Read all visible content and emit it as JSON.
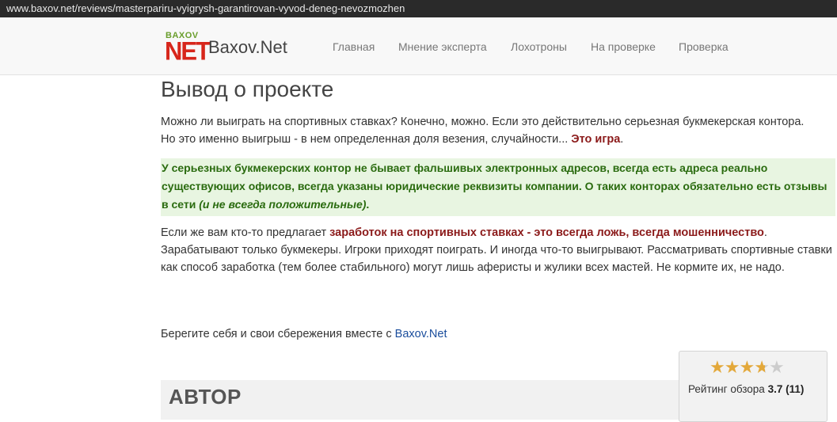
{
  "browser": {
    "url": "www.baxov.net/reviews/masterpariru-vyigrysh-garantirovan-vyvod-deneg-nevozmozhen"
  },
  "header": {
    "logo": {
      "top_text": "BAXOV",
      "main_text": "NET"
    },
    "brand": "Baxov.Net",
    "nav": [
      {
        "label": "Главная"
      },
      {
        "label": "Мнение эксперта"
      },
      {
        "label": "Лохотроны"
      },
      {
        "label": "На проверке"
      },
      {
        "label": "Проверка"
      }
    ]
  },
  "article": {
    "heading": "Вывод о проекте",
    "para1": {
      "line1": "Можно ли выиграть на спортивных ставках? Конечно, можно. Если это действительно серьезная букмекерская контора.",
      "line2_before": "Но это именно выигрыш - в нем определенная доля везения, случайности... ",
      "line2_bold": "Это игра",
      "line2_after": "."
    },
    "highlight": {
      "text": " У серьезных букмекерских контор не бывает фальшивых электронных адресов, всегда есть адреса реально существующих офисов, всегда указаны юридические реквизиты компании. О таких конторах обязательно есть отзывы в сети ",
      "italic": "(и не всегда положительные)",
      "end": "."
    },
    "para2": {
      "before": "Если же вам кто-то предлагает ",
      "bold": "заработок на спортивных ставках - это всегда ложь, всегда мошенничество",
      "after": ". Зарабатывают только букмекеры. Игроки приходят поиграть. И иногда что-то выигрывают. Рассматривать спортивные ставки как способ заработка (тем более стабильного) могут лишь аферисты и жулики всех мастей. Не кормите их, не надо."
    },
    "para3": {
      "before": "Берегите себя и свои сбережения вместе с ",
      "link": "Baxov.Net"
    },
    "author_label": "АВТОР"
  },
  "rating": {
    "label": "Рейтинг обзора",
    "score": "3.7",
    "count": "(11)",
    "value": 3.7,
    "max": 5,
    "star_color": "#e3a83a",
    "star_empty_color": "#cccccc"
  }
}
